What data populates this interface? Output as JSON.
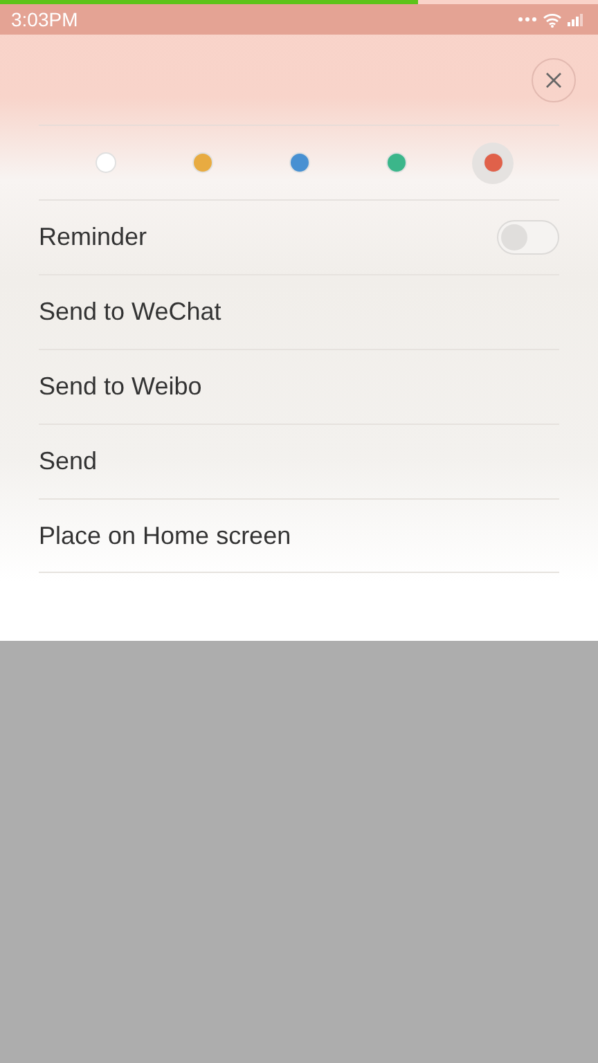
{
  "status_bar": {
    "time": "3:03PM"
  },
  "colors": [
    {
      "color": "#ffffff",
      "selected": false
    },
    {
      "color": "#e8ab41",
      "selected": false
    },
    {
      "color": "#4890d2",
      "selected": false
    },
    {
      "color": "#3bb68a",
      "selected": false
    },
    {
      "color": "#e0614a",
      "selected": true
    }
  ],
  "menu": [
    {
      "kind": "toggle",
      "label": "Reminder",
      "on": false
    },
    {
      "kind": "action",
      "label": "Send to WeChat"
    },
    {
      "kind": "action",
      "label": "Send to Weibo"
    },
    {
      "kind": "action",
      "label": "Send"
    },
    {
      "kind": "action",
      "label": "Place on Home screen"
    }
  ]
}
